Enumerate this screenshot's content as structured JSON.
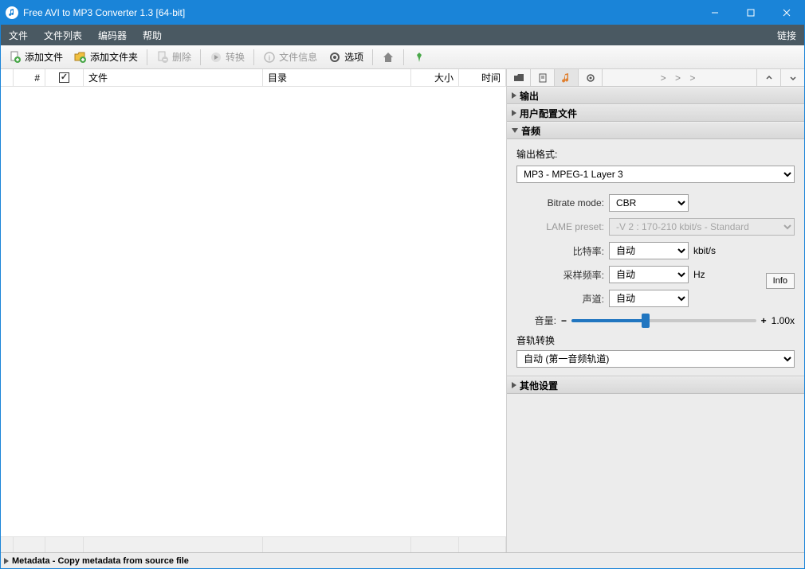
{
  "window": {
    "title": "Free AVI to MP3 Converter 1.3  [64-bit]"
  },
  "menu": {
    "file": "文件",
    "filelist": "文件列表",
    "encoder": "编码器",
    "help": "帮助",
    "link": "链接"
  },
  "toolbar": {
    "add_file": "添加文件",
    "add_folder": "添加文件夹",
    "delete": "删除",
    "convert": "转换",
    "file_info": "文件信息",
    "options": "选项"
  },
  "table": {
    "col_num": "#",
    "col_file": "文件",
    "col_dir": "目录",
    "col_size": "大小",
    "col_time": "时间"
  },
  "right": {
    "section_output": "输出",
    "section_profile": "用户配置文件",
    "section_audio": "音频",
    "section_other": "其他设置",
    "output_format_label": "输出格式:",
    "output_format_value": "MP3 - MPEG-1 Layer 3",
    "bitrate_mode_label": "Bitrate mode:",
    "bitrate_mode_value": "CBR",
    "lame_preset_label": "LAME preset:",
    "lame_preset_value": "-V 2 : 170-210 kbit/s - Standard",
    "bitrate_label": "比特率:",
    "bitrate_value": "自动",
    "bitrate_unit": "kbit/s",
    "sample_label": "采样频率:",
    "sample_value": "自动",
    "sample_unit": "Hz",
    "channel_label": "声道:",
    "channel_value": "自动",
    "volume_label": "音量:",
    "volume_value": "1.00x",
    "info_btn": "Info",
    "track_conv_label": "音轨转换",
    "track_conv_value": "自动 (第一音频轨道)",
    "tabs_more": "> > >"
  },
  "statusbar": {
    "text": "Metadata - Copy metadata from source file"
  }
}
